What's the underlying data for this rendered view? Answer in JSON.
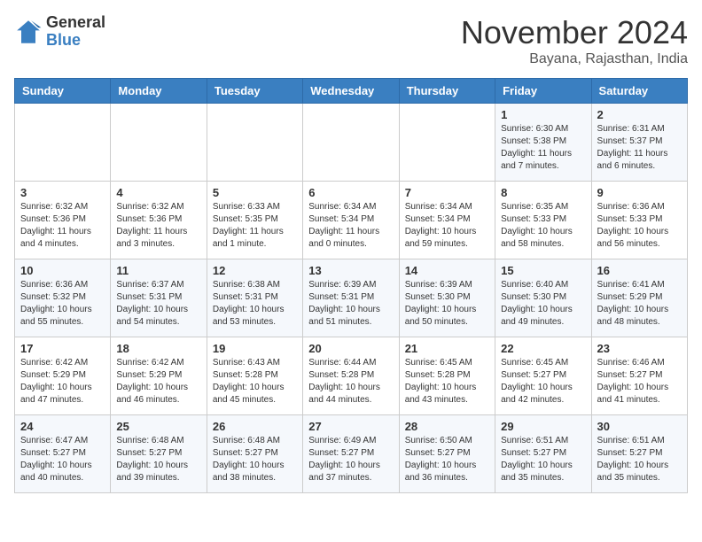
{
  "logo": {
    "general": "General",
    "blue": "Blue"
  },
  "header": {
    "month": "November 2024",
    "location": "Bayana, Rajasthan, India"
  },
  "weekdays": [
    "Sunday",
    "Monday",
    "Tuesday",
    "Wednesday",
    "Thursday",
    "Friday",
    "Saturday"
  ],
  "weeks": [
    [
      {
        "day": "",
        "info": ""
      },
      {
        "day": "",
        "info": ""
      },
      {
        "day": "",
        "info": ""
      },
      {
        "day": "",
        "info": ""
      },
      {
        "day": "",
        "info": ""
      },
      {
        "day": "1",
        "info": "Sunrise: 6:30 AM\nSunset: 5:38 PM\nDaylight: 11 hours and 7 minutes."
      },
      {
        "day": "2",
        "info": "Sunrise: 6:31 AM\nSunset: 5:37 PM\nDaylight: 11 hours and 6 minutes."
      }
    ],
    [
      {
        "day": "3",
        "info": "Sunrise: 6:32 AM\nSunset: 5:36 PM\nDaylight: 11 hours and 4 minutes."
      },
      {
        "day": "4",
        "info": "Sunrise: 6:32 AM\nSunset: 5:36 PM\nDaylight: 11 hours and 3 minutes."
      },
      {
        "day": "5",
        "info": "Sunrise: 6:33 AM\nSunset: 5:35 PM\nDaylight: 11 hours and 1 minute."
      },
      {
        "day": "6",
        "info": "Sunrise: 6:34 AM\nSunset: 5:34 PM\nDaylight: 11 hours and 0 minutes."
      },
      {
        "day": "7",
        "info": "Sunrise: 6:34 AM\nSunset: 5:34 PM\nDaylight: 10 hours and 59 minutes."
      },
      {
        "day": "8",
        "info": "Sunrise: 6:35 AM\nSunset: 5:33 PM\nDaylight: 10 hours and 58 minutes."
      },
      {
        "day": "9",
        "info": "Sunrise: 6:36 AM\nSunset: 5:33 PM\nDaylight: 10 hours and 56 minutes."
      }
    ],
    [
      {
        "day": "10",
        "info": "Sunrise: 6:36 AM\nSunset: 5:32 PM\nDaylight: 10 hours and 55 minutes."
      },
      {
        "day": "11",
        "info": "Sunrise: 6:37 AM\nSunset: 5:31 PM\nDaylight: 10 hours and 54 minutes."
      },
      {
        "day": "12",
        "info": "Sunrise: 6:38 AM\nSunset: 5:31 PM\nDaylight: 10 hours and 53 minutes."
      },
      {
        "day": "13",
        "info": "Sunrise: 6:39 AM\nSunset: 5:31 PM\nDaylight: 10 hours and 51 minutes."
      },
      {
        "day": "14",
        "info": "Sunrise: 6:39 AM\nSunset: 5:30 PM\nDaylight: 10 hours and 50 minutes."
      },
      {
        "day": "15",
        "info": "Sunrise: 6:40 AM\nSunset: 5:30 PM\nDaylight: 10 hours and 49 minutes."
      },
      {
        "day": "16",
        "info": "Sunrise: 6:41 AM\nSunset: 5:29 PM\nDaylight: 10 hours and 48 minutes."
      }
    ],
    [
      {
        "day": "17",
        "info": "Sunrise: 6:42 AM\nSunset: 5:29 PM\nDaylight: 10 hours and 47 minutes."
      },
      {
        "day": "18",
        "info": "Sunrise: 6:42 AM\nSunset: 5:29 PM\nDaylight: 10 hours and 46 minutes."
      },
      {
        "day": "19",
        "info": "Sunrise: 6:43 AM\nSunset: 5:28 PM\nDaylight: 10 hours and 45 minutes."
      },
      {
        "day": "20",
        "info": "Sunrise: 6:44 AM\nSunset: 5:28 PM\nDaylight: 10 hours and 44 minutes."
      },
      {
        "day": "21",
        "info": "Sunrise: 6:45 AM\nSunset: 5:28 PM\nDaylight: 10 hours and 43 minutes."
      },
      {
        "day": "22",
        "info": "Sunrise: 6:45 AM\nSunset: 5:27 PM\nDaylight: 10 hours and 42 minutes."
      },
      {
        "day": "23",
        "info": "Sunrise: 6:46 AM\nSunset: 5:27 PM\nDaylight: 10 hours and 41 minutes."
      }
    ],
    [
      {
        "day": "24",
        "info": "Sunrise: 6:47 AM\nSunset: 5:27 PM\nDaylight: 10 hours and 40 minutes."
      },
      {
        "day": "25",
        "info": "Sunrise: 6:48 AM\nSunset: 5:27 PM\nDaylight: 10 hours and 39 minutes."
      },
      {
        "day": "26",
        "info": "Sunrise: 6:48 AM\nSunset: 5:27 PM\nDaylight: 10 hours and 38 minutes."
      },
      {
        "day": "27",
        "info": "Sunrise: 6:49 AM\nSunset: 5:27 PM\nDaylight: 10 hours and 37 minutes."
      },
      {
        "day": "28",
        "info": "Sunrise: 6:50 AM\nSunset: 5:27 PM\nDaylight: 10 hours and 36 minutes."
      },
      {
        "day": "29",
        "info": "Sunrise: 6:51 AM\nSunset: 5:27 PM\nDaylight: 10 hours and 35 minutes."
      },
      {
        "day": "30",
        "info": "Sunrise: 6:51 AM\nSunset: 5:27 PM\nDaylight: 10 hours and 35 minutes."
      }
    ]
  ]
}
